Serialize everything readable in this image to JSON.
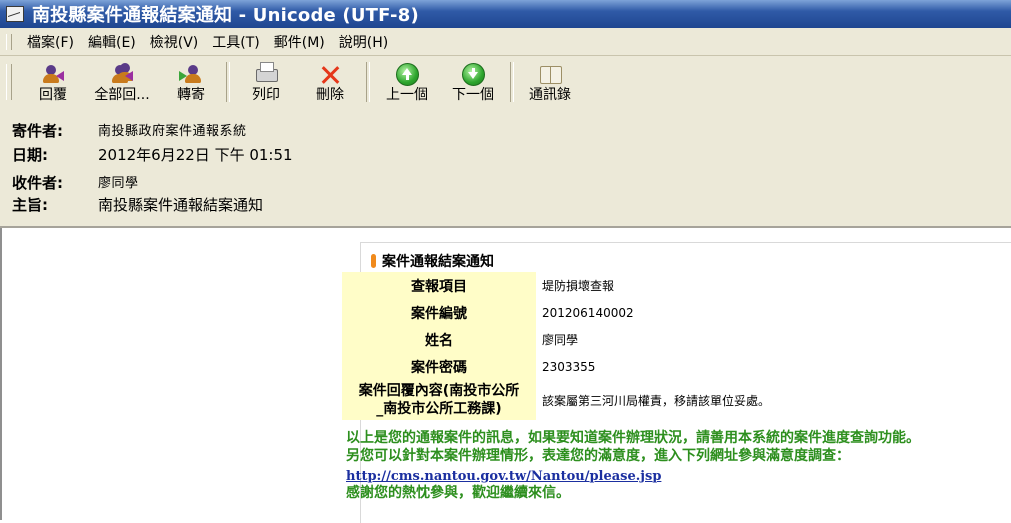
{
  "window": {
    "title": "南投縣案件通報結案通知 - Unicode (UTF-8)"
  },
  "menu": [
    "檔案(F)",
    "編輯(E)",
    "檢視(V)",
    "工具(T)",
    "郵件(M)",
    "說明(H)"
  ],
  "toolbar": {
    "reply": "回覆",
    "reply_all": "全部回...",
    "forward": "轉寄",
    "print": "列印",
    "delete": "刪除",
    "prev": "上一個",
    "next": "下一個",
    "contacts": "通訊錄"
  },
  "header": {
    "from_label": "寄件者:",
    "from_value": "南投縣政府案件通報系統",
    "date_label": "日期:",
    "date_value": "2012年6月22日 下午 01:51",
    "to_label": "收件者:",
    "to_value": "廖同學",
    "subject_label": "主旨:",
    "subject_value": "南投縣案件通報結案通知"
  },
  "body": {
    "panel_title": "案件通報結案通知",
    "rows": [
      {
        "label": "查報項目",
        "value": "堤防損壞查報"
      },
      {
        "label": "案件編號",
        "value": "201206140002"
      },
      {
        "label": "姓名",
        "value": "廖同學"
      },
      {
        "label": "案件密碼",
        "value": "2303355"
      },
      {
        "label_line1": "案件回覆內容(南投市公所",
        "label_line2": "_南投市公所工務課)",
        "value": "該案屬第三河川局權責，移請該單位妥處。"
      }
    ],
    "message_line1": "以上是您的通報案件的訊息，如果要知道案件辦理狀況，請善用本系統的案件進度查詢功能。",
    "message_line2": "另您可以針對本案件辦理情形，表達您的滿意度，進入下列網址參與滿意度調查：",
    "link": "http://cms.nantou.gov.tw/Nantou/please.jsp",
    "thanks": "感謝您的熱忱參與，歡迎繼續來信。"
  },
  "colors": {
    "title_bar": "#2f5aa7",
    "chrome": "#ece9d8",
    "label_cell": "#fffdc8",
    "message_text": "#2d8f1e",
    "link": "#1b2fa0"
  }
}
